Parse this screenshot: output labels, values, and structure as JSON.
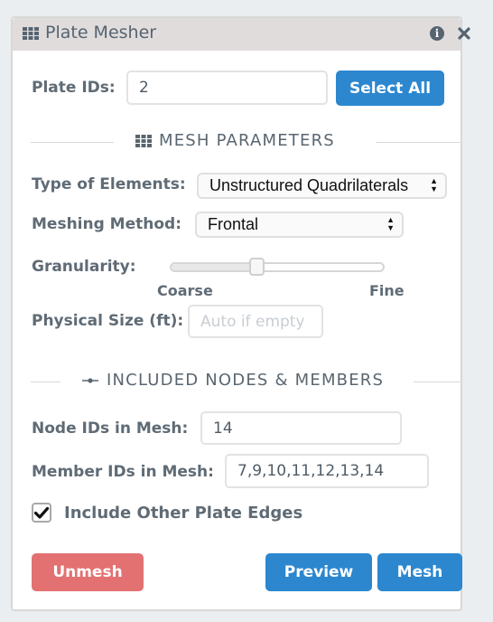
{
  "window": {
    "title": "Plate Mesher",
    "title_icon": "grid-icon",
    "info_icon": "info-icon",
    "info_glyph": "i",
    "close_icon": "close-icon"
  },
  "plate_ids": {
    "label": "Plate IDs:",
    "value": "2",
    "select_all_label": "Select All"
  },
  "mesh_parameters": {
    "section_title": "MESH PARAMETERS",
    "section_icon": "grid-icon",
    "type_of_elements": {
      "label": "Type of Elements:",
      "selected": "Unstructured Quadrilaterals"
    },
    "meshing_method": {
      "label": "Meshing Method:",
      "selected": "Frontal"
    },
    "granularity": {
      "label": "Granularity:",
      "value_fraction": 0.4,
      "min_label": "Coarse",
      "max_label": "Fine"
    },
    "physical_size": {
      "label": "Physical Size (ft):",
      "value": "",
      "placeholder": "Auto if empty"
    }
  },
  "included": {
    "section_title": "INCLUDED NODES & MEMBERS",
    "section_icon": "node-icon",
    "node_ids": {
      "label": "Node IDs in Mesh:",
      "value": "14"
    },
    "member_ids": {
      "label": "Member IDs in Mesh:",
      "value": "7,9,10,11,12,13,14"
    },
    "include_other_plate_edges": {
      "label": "Include Other Plate Edges",
      "checked": true
    }
  },
  "actions": {
    "unmesh_label": "Unmesh",
    "preview_label": "Preview",
    "mesh_label": "Mesh"
  },
  "colors": {
    "primary": "#2c87cf",
    "danger": "#e37172",
    "text": "#5f6b75",
    "titlebar": "#e0dcdc"
  }
}
